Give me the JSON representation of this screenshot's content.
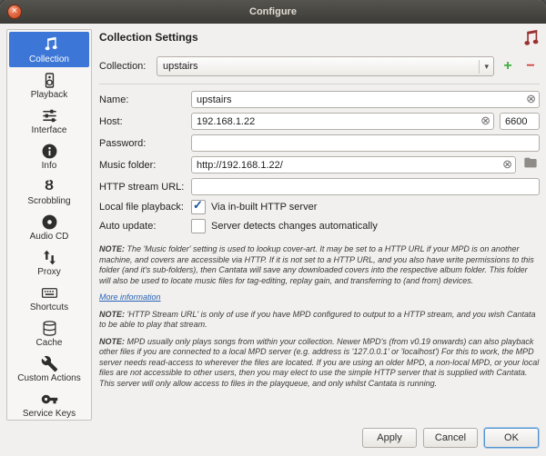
{
  "window": {
    "title": "Configure"
  },
  "icons": {
    "close": "×",
    "combo_arrow": "▾",
    "clear": "⊗",
    "scrobbling_glyph": "Ȣ"
  },
  "sidebar": {
    "items": [
      {
        "label": "Collection",
        "icon": "music-note-icon",
        "selected": true
      },
      {
        "label": "Playback",
        "icon": "speaker-icon",
        "selected": false
      },
      {
        "label": "Interface",
        "icon": "sliders-icon",
        "selected": false
      },
      {
        "label": "Info",
        "icon": "info-icon",
        "selected": false
      },
      {
        "label": "Scrobbling",
        "icon": "scrobbling-icon",
        "selected": false
      },
      {
        "label": "Audio CD",
        "icon": "cd-icon",
        "selected": false
      },
      {
        "label": "Proxy",
        "icon": "proxy-icon",
        "selected": false
      },
      {
        "label": "Shortcuts",
        "icon": "keyboard-icon",
        "selected": false
      },
      {
        "label": "Cache",
        "icon": "cache-icon",
        "selected": false
      },
      {
        "label": "Custom Actions",
        "icon": "wrench-icon",
        "selected": false
      },
      {
        "label": "Service Keys",
        "icon": "key-icon",
        "selected": false
      }
    ]
  },
  "main": {
    "title": "Collection Settings",
    "collection_row": {
      "label": "Collection:",
      "value": "upstairs",
      "add_label": "+",
      "remove_label": "−"
    },
    "fields": {
      "name": {
        "label": "Name:",
        "value": "upstairs"
      },
      "host": {
        "label": "Host:",
        "value": "192.168.1.22",
        "port": "6600"
      },
      "password": {
        "label": "Password:",
        "value": ""
      },
      "music_folder": {
        "label": "Music folder:",
        "value": "http://192.168.1.22/"
      },
      "http_stream_url": {
        "label": "HTTP stream URL:",
        "value": ""
      },
      "local_file_playback": {
        "label": "Local file playback:",
        "option": "Via in-built HTTP server",
        "checked": true
      },
      "auto_update": {
        "label": "Auto update:",
        "option": "Server detects changes automatically",
        "checked": false
      }
    },
    "notes": {
      "note1_prefix": "NOTE:",
      "note1": " The 'Music folder' setting is used to lookup cover-art. It may be set to a HTTP URL if your MPD is on another machine, and covers are accessible via HTTP. If it is not set to a HTTP URL, and you also have write permissions to this folder (and it's sub-folders), then Cantata will save any downloaded covers into the respective album folder. This folder will also be used to locate music files for tag-editing, replay gain, and transferring to (and from) devices.",
      "more_info_link": "More information",
      "note2_prefix": "NOTE:",
      "note2": " 'HTTP Stream URL' is only of use if you have MPD configured to output to a HTTP stream, and you wish Cantata to be able to play that stream.",
      "note3_prefix": "NOTE:",
      "note3": " MPD usually only plays songs from within your collection. Newer MPD's (from v0.19 onwards) can also playback other files if you are connected to a local MPD server (e.g. address is '127.0.0.1' or 'localhost') For this to work, the MPD server needs read-access to wherever the files are located. If you are using an older MPD, a non-local MPD, or your local files are not accessible to other users, then you may elect to use the simple HTTP server that is supplied with Cantata. This server will only allow access to files in the playqueue, and only whilst Cantata is running."
    }
  },
  "footer": {
    "apply": "Apply",
    "cancel": "Cancel",
    "ok": "OK"
  },
  "colors": {
    "accent_blue": "#3c76d6",
    "add_green": "#3fae3f",
    "remove_red": "#d23c3c",
    "header_icon_red": "#9b3030",
    "link_blue": "#2a62b8"
  }
}
